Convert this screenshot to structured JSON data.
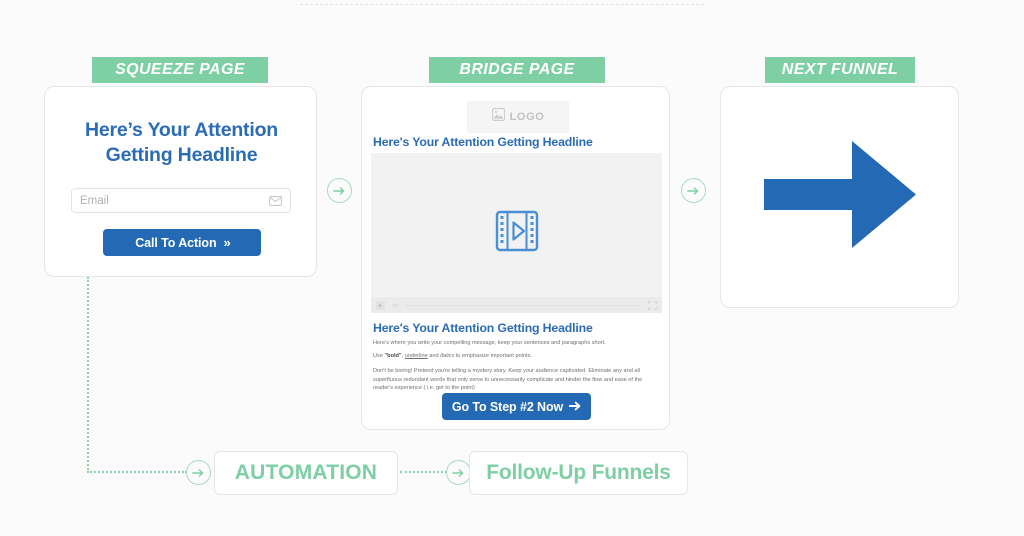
{
  "theme": {
    "background": "#fbfbfb",
    "green": "#7ecfa4",
    "green_line": "#8bd3ab",
    "blue": "#2369b3",
    "headline_blue": "#2b6cb5",
    "card_border": "#e6e6e6"
  },
  "labels": {
    "squeeze": "SQUEEZE PAGE",
    "bridge": "BRIDGE PAGE",
    "next": "NEXT FUNNEL"
  },
  "squeeze_page": {
    "headline": "Here’s Your Attention Getting Headline",
    "email_placeholder": "Email",
    "email_value": "",
    "email_icon": "envelope-icon",
    "cta_label": "Call To Action",
    "cta_icon": "double-chevron-right-icon"
  },
  "bridge_page": {
    "logo_text": "LOGO",
    "logo_icon": "image-placeholder-icon",
    "headline": "Here's Your Attention Getting Headline",
    "video_icon": "video-play-icon",
    "player": {
      "play_icon": "play-icon",
      "volume_icon": "volume-icon",
      "fullscreen_icon": "fullscreen-icon"
    },
    "subheadline": "Here's Your Attention Getting Headline",
    "paragraph_1": "Here's where you write your compelling message, keep your sentences and paragraphs short.",
    "paragraph_2_pre": "Use ",
    "paragraph_2_bold": "\"bold\"",
    "paragraph_2_mid": ", ",
    "paragraph_2_underline": "underline",
    "paragraph_2_mid2": " and ",
    "paragraph_2_italic": "italics",
    "paragraph_2_post": " to emphasize important points.",
    "paragraph_3": "Don't be boring! Pretend you're telling a mystery story. Keep your audience captivated. Eliminate any and all superfluous redundant words that only serve to unnecessarily complicate and hinder the flow and ease of the reader's experience ( i.e. get to the point)",
    "cta_label": "Go To Step #2 Now",
    "cta_icon": "arrow-right-icon"
  },
  "next_funnel": {
    "arrow_icon": "big-arrow-right-icon"
  },
  "connectors": {
    "arrow_icon": "circle-arrow-right-icon",
    "count": 4
  },
  "bottom_row": {
    "automation_label": "AUTOMATION",
    "followup_label": "Follow-Up Funnels"
  }
}
